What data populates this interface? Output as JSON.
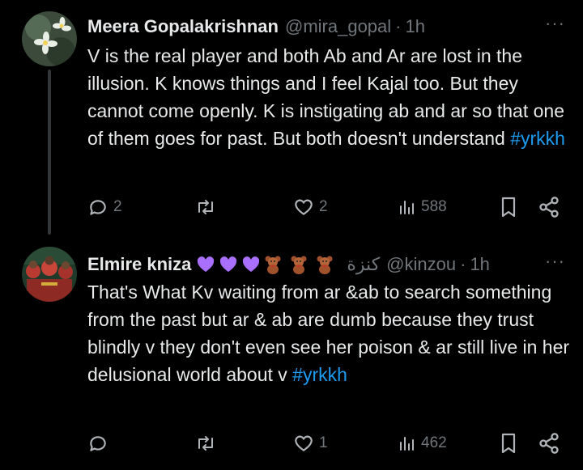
{
  "tweets": [
    {
      "author_name": "Meera Gopalakrishnan",
      "handle": "@mira_gopal",
      "separator": "·",
      "time": "1h",
      "more": "···",
      "text": "V is the real player and both Ab and Ar are lost in the illusion. K knows things and I feel Kajal too. But they cannot come openly. K is instigating ab and ar so that one of them goes for past. But both doesn't understand ",
      "hashtag": "#yrkkh",
      "stats": {
        "replies": "2",
        "retweets": "",
        "likes": "2",
        "views": "588"
      }
    },
    {
      "author_name": "Elmire kniza",
      "name_emojis": [
        "purple-heart",
        "purple-heart",
        "purple-heart",
        "teddy-bear",
        "teddy-bear",
        "teddy-bear"
      ],
      "arabic_name": "كنزة",
      "handle": "@kinzou",
      "separator": "·",
      "time": "1h",
      "more": "···",
      "text": "That's What Kv waiting from ar &ab to search something from the past but ar & ab are dumb because they trust blindly v they don't even see her poison & ar still live in her delusional world about v ",
      "hashtag": "#yrkkh",
      "stats": {
        "replies": "",
        "retweets": "",
        "likes": "1",
        "views": "462"
      }
    }
  ],
  "colors": {
    "background": "#000000",
    "text": "#e7e9ea",
    "muted": "#71767b",
    "link": "#1d9bf0",
    "heart": "#a970ff"
  }
}
